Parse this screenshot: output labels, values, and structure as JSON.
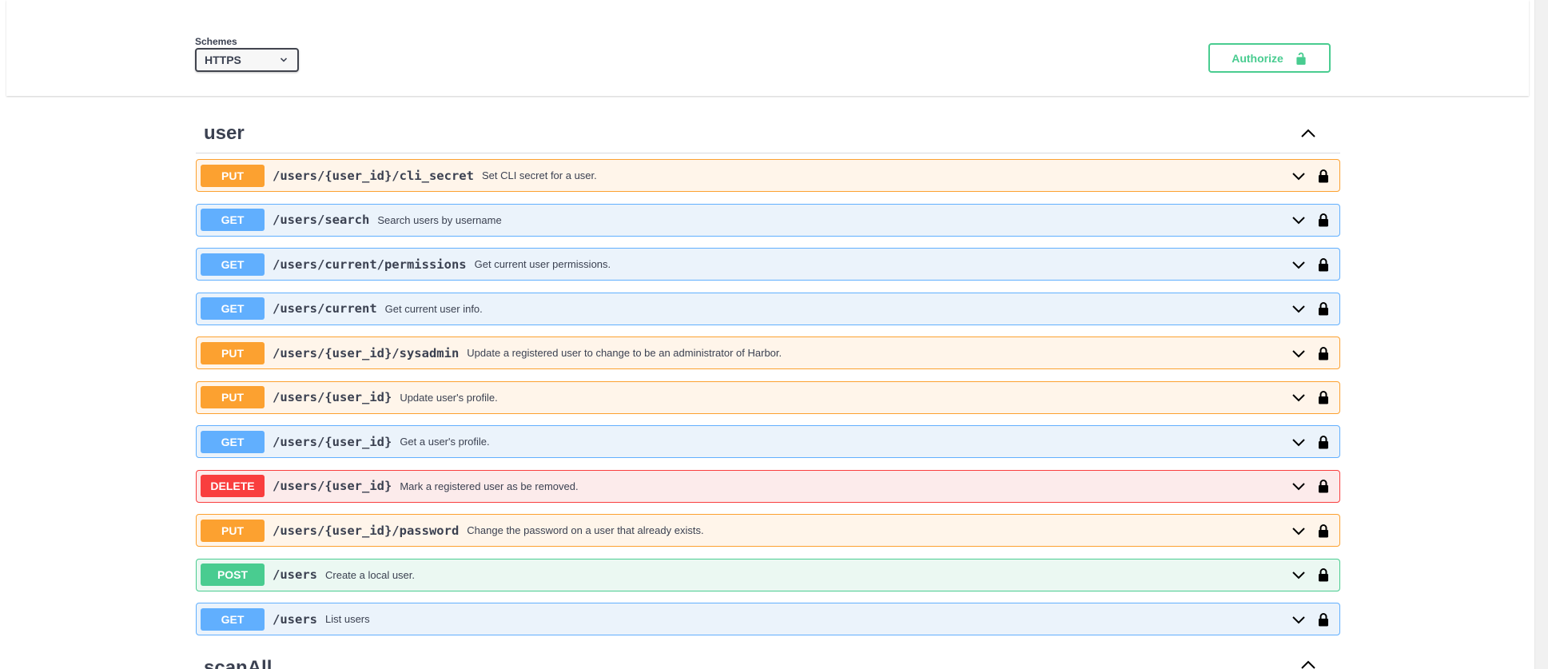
{
  "schemes": {
    "label": "Schemes",
    "selected": "HTTPS"
  },
  "authorize": {
    "label": "Authorize"
  },
  "tag": {
    "name": "user"
  },
  "operations": [
    {
      "method": "PUT",
      "path": "/users/{user_id}/cli_secret",
      "summary": "Set CLI secret for a user."
    },
    {
      "method": "GET",
      "path": "/users/search",
      "summary": "Search users by username"
    },
    {
      "method": "GET",
      "path": "/users/current/permissions",
      "summary": "Get current user permissions."
    },
    {
      "method": "GET",
      "path": "/users/current",
      "summary": "Get current user info."
    },
    {
      "method": "PUT",
      "path": "/users/{user_id}/sysadmin",
      "summary": "Update a registered user to change to be an administrator of Harbor."
    },
    {
      "method": "PUT",
      "path": "/users/{user_id}",
      "summary": "Update user's profile."
    },
    {
      "method": "GET",
      "path": "/users/{user_id}",
      "summary": "Get a user's profile."
    },
    {
      "method": "DELETE",
      "path": "/users/{user_id}",
      "summary": "Mark a registered user as be removed."
    },
    {
      "method": "PUT",
      "path": "/users/{user_id}/password",
      "summary": "Change the password on a user that already exists."
    },
    {
      "method": "POST",
      "path": "/users",
      "summary": "Create a local user."
    },
    {
      "method": "GET",
      "path": "/users",
      "summary": "List users"
    }
  ],
  "next_tag": {
    "name": "scanAll"
  },
  "colors": {
    "put": "#fca130",
    "get": "#61affe",
    "delete": "#f93e3e",
    "post": "#49cc90"
  },
  "icons": {
    "schemes_dropdown": "chevron-down-icon",
    "authorize": "unlocked-lock-icon",
    "tag_toggle": "chevron-up-icon",
    "op_expand": "chevron-down-icon",
    "op_auth": "locked-lock-icon"
  }
}
